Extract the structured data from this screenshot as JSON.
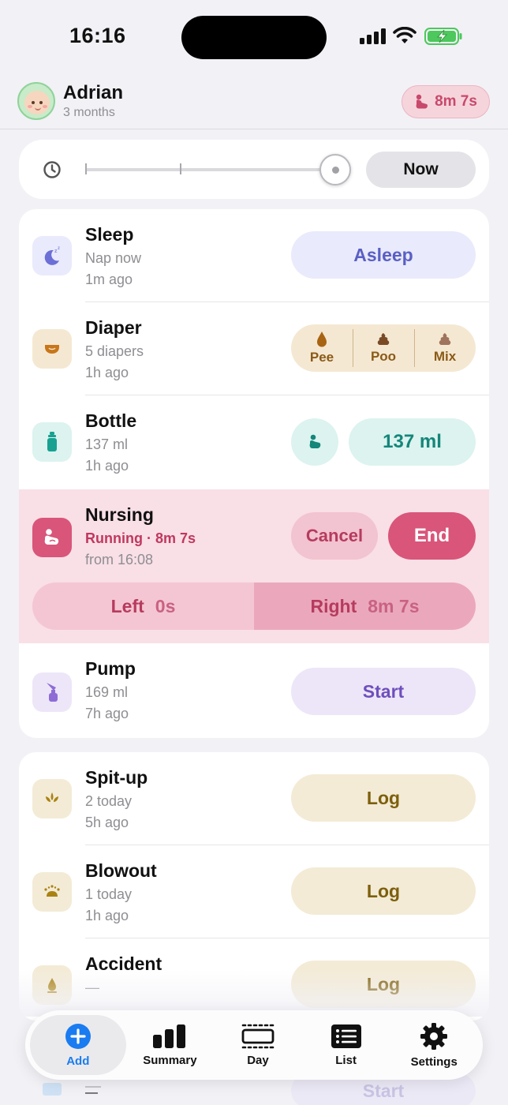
{
  "status_bar": {
    "time": "16:16"
  },
  "header": {
    "name": "Adrian",
    "age": "3 months",
    "active_timer": "8m 7s",
    "avatar_icon": "baby-face-icon",
    "timer_icon": "nursing-icon"
  },
  "time_slider": {
    "icon": "clock-icon",
    "now_label": "Now",
    "position": 1.0
  },
  "tracking": [
    {
      "title": "Sleep",
      "line1": "Nap now",
      "line2": "1m ago",
      "action": "Asleep",
      "icon": "moon-icon",
      "color": "#5a5fc4"
    },
    {
      "title": "Diaper",
      "line1": "5 diapers",
      "line2": "1h ago",
      "options": [
        "Pee",
        "Poo",
        "Mix"
      ],
      "icon": "diaper-icon",
      "color": "#8a5a17"
    },
    {
      "title": "Bottle",
      "line1": "137 ml",
      "line2": "1h ago",
      "action": "137 ml",
      "icon": "bottle-icon",
      "color": "#14867a"
    },
    {
      "title": "Nursing",
      "line1": "Running · 8m 7s",
      "line2": "from 16:08",
      "cancel": "Cancel",
      "end": "End",
      "left_label": "Left",
      "left_value": "0s",
      "right_label": "Right",
      "right_value": "8m 7s",
      "icon": "nursing-icon",
      "color": "#d9557a"
    },
    {
      "title": "Pump",
      "line1": "169 ml",
      "line2": "7h ago",
      "action": "Start",
      "icon": "pump-icon",
      "color": "#7a5cc4"
    }
  ],
  "incidents": [
    {
      "title": "Spit-up",
      "line1": "2 today",
      "line2": "5h ago",
      "action": "Log",
      "icon": "spit-up-icon"
    },
    {
      "title": "Blowout",
      "line1": "1 today",
      "line2": "1h ago",
      "action": "Log",
      "icon": "blowout-icon"
    },
    {
      "title": "Accident",
      "line1": "—",
      "action": "Log",
      "icon": "accident-icon"
    }
  ],
  "peek_row": {
    "line1": "—",
    "action": "Start"
  },
  "tabbar": [
    {
      "label": "Add",
      "icon": "plus-circle-icon",
      "active": true
    },
    {
      "label": "Summary",
      "icon": "bar-chart-icon"
    },
    {
      "label": "Day",
      "icon": "day-timeline-icon"
    },
    {
      "label": "List",
      "icon": "list-icon"
    },
    {
      "label": "Settings",
      "icon": "gear-icon"
    }
  ],
  "colors": {
    "accent_blue": "#1a7cf0",
    "nursing_pink": "#d9557a",
    "log_beige": "#f3ebd6",
    "sleep_lavender": "#e9eafb",
    "bottle_mint": "#dcf3ef"
  }
}
